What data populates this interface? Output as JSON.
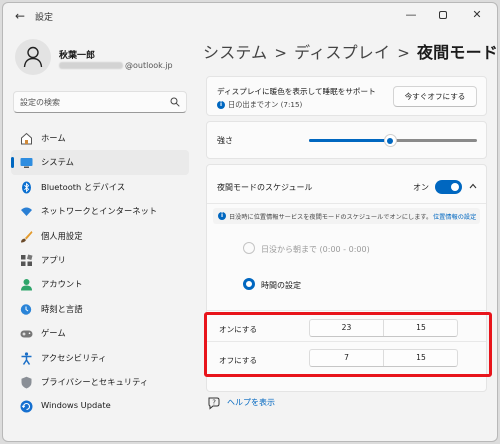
{
  "window": {
    "title": "設定",
    "back_icon": "back-arrow-icon",
    "controls": [
      "minimize-icon",
      "maximize-icon",
      "close-icon"
    ]
  },
  "user": {
    "name": "秋葉一郎",
    "email_suffix": "@outlook.jp"
  },
  "search": {
    "placeholder": "設定の検索"
  },
  "sidebar": {
    "items": [
      {
        "label": "ホーム",
        "icon": "home-icon"
      },
      {
        "label": "システム",
        "icon": "system-monitor-icon",
        "active": true
      },
      {
        "label": "Bluetooth とデバイス",
        "icon": "bluetooth-icon"
      },
      {
        "label": "ネットワークとインターネット",
        "icon": "wifi-icon"
      },
      {
        "label": "個人用設定",
        "icon": "brush-icon"
      },
      {
        "label": "アプリ",
        "icon": "apps-icon"
      },
      {
        "label": "アカウント",
        "icon": "account-icon"
      },
      {
        "label": "時刻と言語",
        "icon": "time-language-icon"
      },
      {
        "label": "ゲーム",
        "icon": "game-controller-icon"
      },
      {
        "label": "アクセシビリティ",
        "icon": "accessibility-icon"
      },
      {
        "label": "プライバシーとセキュリティ",
        "icon": "shield-icon"
      },
      {
        "label": "Windows Update",
        "icon": "update-icon"
      }
    ]
  },
  "breadcrumb": {
    "level1": "システム",
    "level2": "ディスプレイ",
    "current": "夜間モード",
    "separator": ">"
  },
  "night_light": {
    "title": "ディスプレイに暖色を表示して睡眠をサポート",
    "status": "日の出までオン (7:15)",
    "off_button": "今すぐオフにする"
  },
  "strength": {
    "label": "強さ",
    "value_fraction": 0.48
  },
  "schedule": {
    "title": "夜間モードのスケジュール",
    "toggle_label": "オン",
    "toggle_on": true,
    "info_text": "日没時に位置情報サービスを夜間モードのスケジュールでオンにします。",
    "info_link": "位置情報の設定",
    "option_sunset": "日没から朝まで (0:00 - 0:00)",
    "option_custom": "時間の設定",
    "selected_option": "custom",
    "turn_on": {
      "label": "オンにする",
      "hour": "23",
      "minute": "15"
    },
    "turn_off": {
      "label": "オフにする",
      "hour": "7",
      "minute": "15"
    }
  },
  "help": {
    "label": "ヘルプを表示",
    "icon": "help-icon"
  },
  "colors": {
    "accent": "#0067c0",
    "highlight": "#e8141b"
  }
}
